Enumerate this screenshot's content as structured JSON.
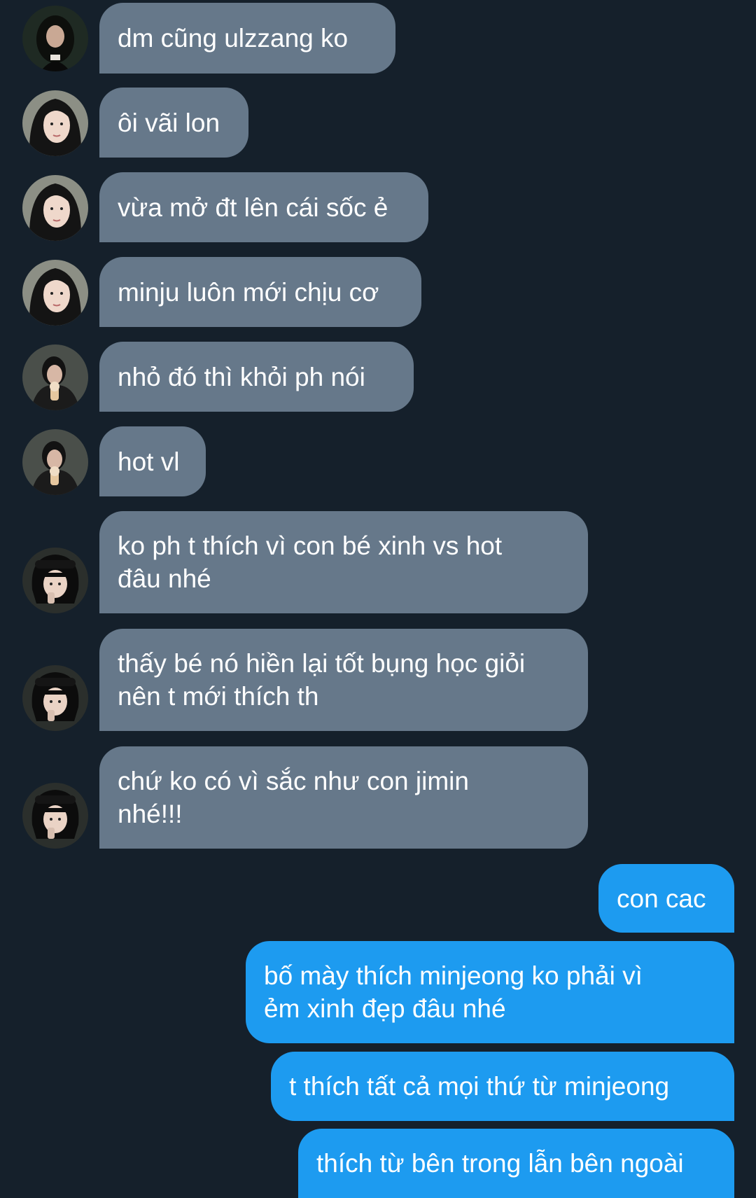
{
  "conversation": {
    "incoming": [
      {
        "text": "dm cũng ulzzang ko",
        "avatar": "avatar-a"
      },
      {
        "text": "ôi vãi lon",
        "avatar": "avatar-b"
      },
      {
        "text": "vừa mở đt lên cái sốc ẻ",
        "avatar": "avatar-b"
      },
      {
        "text": "minju luôn mới chịu cơ",
        "avatar": "avatar-b"
      },
      {
        "text": "nhỏ đó thì khỏi ph nói",
        "avatar": "avatar-c"
      },
      {
        "text": "hot vl",
        "avatar": "avatar-c"
      },
      {
        "text": "ko ph t thích vì con bé xinh vs hot\nđâu nhé",
        "avatar": "avatar-d"
      },
      {
        "text": "thấy bé nó hiền lại tốt bụng học giỏi\nnên t mới thích th",
        "avatar": "avatar-d"
      },
      {
        "text": "chứ ko có vì sắc như con jimin\nnhé!!!",
        "avatar": "avatar-d"
      }
    ],
    "outgoing": [
      {
        "text": "con cac"
      },
      {
        "text": "bố mày thích minjeong ko phải vì\nẻm xinh đẹp đâu nhé"
      },
      {
        "text": "t thích tất cả mọi thứ từ minjeong"
      },
      {
        "text": "thích từ bên trong lẫn bên ngoài"
      }
    ]
  },
  "colors": {
    "background": "#15202b",
    "incoming_bubble": "#66788a",
    "outgoing_bubble": "#1d9bf0",
    "text": "#ffffff"
  }
}
